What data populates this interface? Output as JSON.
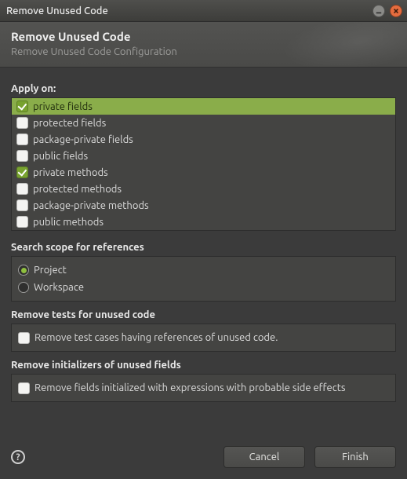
{
  "window": {
    "title": "Remove Unused Code"
  },
  "header": {
    "title": "Remove Unused Code",
    "subtitle": "Remove Unused Code Configuration"
  },
  "apply": {
    "label": "Apply on:",
    "items": [
      {
        "label": "private fields",
        "checked": true,
        "selected": true
      },
      {
        "label": "protected fields",
        "checked": false,
        "selected": false
      },
      {
        "label": "package-private fields",
        "checked": false,
        "selected": false
      },
      {
        "label": "public fields",
        "checked": false,
        "selected": false
      },
      {
        "label": "private methods",
        "checked": true,
        "selected": false
      },
      {
        "label": "protected methods",
        "checked": false,
        "selected": false
      },
      {
        "label": "package-private methods",
        "checked": false,
        "selected": false
      },
      {
        "label": "public methods",
        "checked": false,
        "selected": false
      }
    ]
  },
  "scope": {
    "label": "Search scope for references",
    "options": [
      {
        "label": "Project",
        "checked": true
      },
      {
        "label": "Workspace",
        "checked": false
      }
    ]
  },
  "tests": {
    "label": "Remove tests for unused code",
    "checkbox": {
      "label": "Remove test cases having references of unused code.",
      "checked": false
    }
  },
  "inits": {
    "label": "Remove initializers of unused fields",
    "checkbox": {
      "label": "Remove fields initialized with expressions with probable side effects",
      "checked": false
    }
  },
  "buttons": {
    "cancel": "Cancel",
    "finish": "Finish"
  }
}
